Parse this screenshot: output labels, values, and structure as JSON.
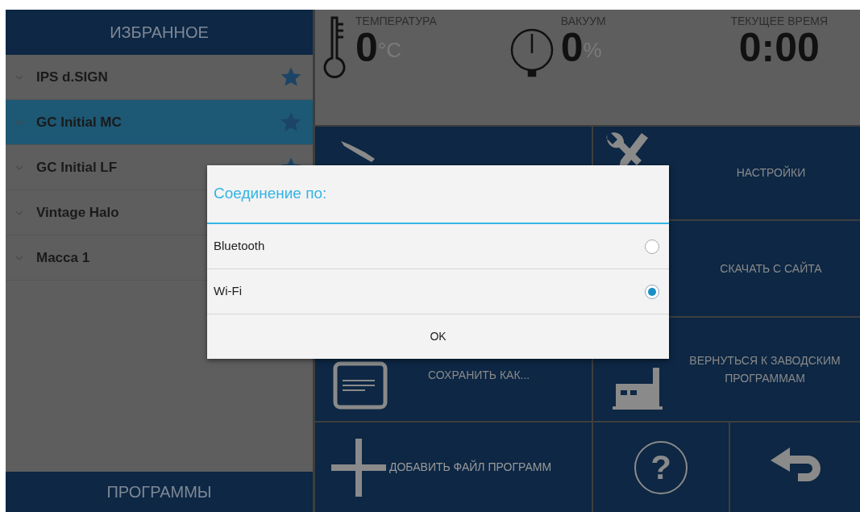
{
  "sidebar": {
    "title": "ИЗБРАННОЕ",
    "items": [
      {
        "label": "IPS d.SIGN",
        "selected": false
      },
      {
        "label": "GC Initial MC",
        "selected": true
      },
      {
        "label": "GC Initial LF",
        "selected": false
      },
      {
        "label": "Vintage Halo",
        "selected": false
      },
      {
        "label": "Macca 1",
        "selected": false
      }
    ],
    "footer": "ПРОГРАММЫ"
  },
  "status": [
    {
      "kind": "temperature",
      "label": "ТЕМПЕРАТУРА",
      "value": "0",
      "unit": "°C"
    },
    {
      "kind": "vacuum",
      "label": "ВАКУУМ",
      "value": "0",
      "unit": "%"
    },
    {
      "kind": "time",
      "label": "ТЕКУЩЕЕ ВРЕМЯ",
      "value": "0:00"
    }
  ],
  "tiles": [
    {
      "kind": "hidden"
    },
    {
      "kind": "settings",
      "label": "НАСТРОЙКИ"
    },
    {
      "kind": "download",
      "label": "СКАЧАТЬ С САЙТА"
    },
    {
      "kind": "save",
      "label": "СОХРАНИТЬ КАК..."
    },
    {
      "kind": "factory",
      "label": "ВЕРНУТЬСЯ К ЗАВОДСКИМ ПРОГРАММАМ"
    },
    {
      "kind": "add",
      "label": "ДОБАВИТЬ ФАЙЛ ПРОГРАММ"
    },
    {
      "kind": "help",
      "label": "?"
    },
    {
      "kind": "back"
    }
  ],
  "dialog": {
    "title": "Соединение по:",
    "options": [
      {
        "label": "Bluetooth",
        "selected": false
      },
      {
        "label": "Wi-Fi",
        "selected": true
      }
    ],
    "button": "OK"
  }
}
